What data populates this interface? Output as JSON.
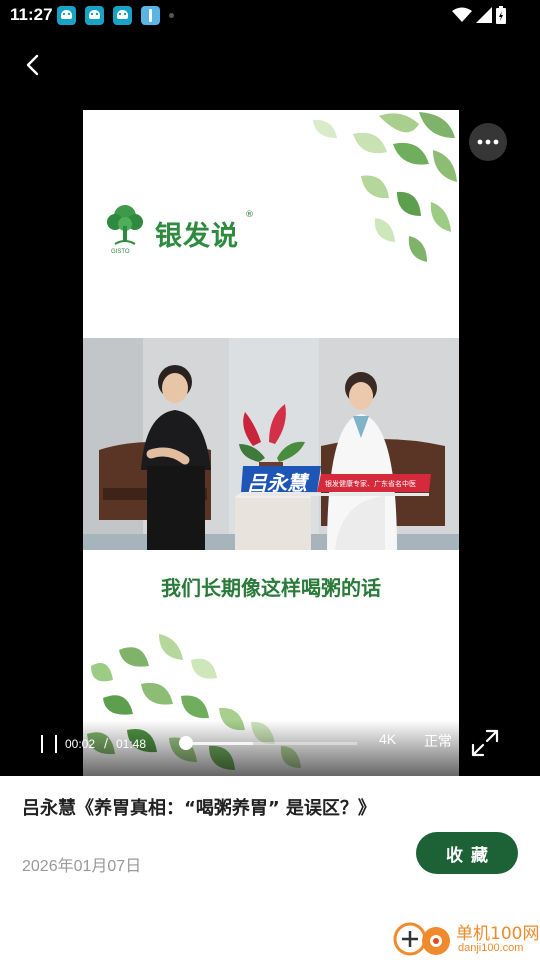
{
  "status_bar": {
    "time": "11:27",
    "notification_icons": [
      "app-notification-icon",
      "app-notification-icon",
      "app-notification-icon",
      "info-notification-icon"
    ],
    "system_icons": [
      "wifi-icon",
      "cellular-signal-icon",
      "battery-icon"
    ]
  },
  "video": {
    "logo_name": "银发说",
    "logo_sub": "GISTO",
    "logo_registered": "®",
    "speaker_name": "吕永慧",
    "speaker_title": "银发健康专家、广东省名中医",
    "caption": "我们长期像这样喝粥的话",
    "controls": {
      "current_time": "00:02",
      "separator": "/",
      "total_time": "01:48",
      "progress_fraction": 0.02,
      "buffered_fraction": 0.4,
      "quality": "4K",
      "speed": "正常"
    }
  },
  "info": {
    "title": "吕永慧《养胃真相：“喝粥养胃” 是误区？》",
    "date": "2026年01月07日",
    "favorite_label": "收藏"
  },
  "watermark": {
    "name": "单机100网",
    "url": "danji100.com"
  },
  "colors": {
    "brand_green": "#1d6137",
    "leaf_green": "#6fae5c",
    "caption_green": "#2a7a3a",
    "banner_blue": "#1e56b8",
    "watermark_orange": "#f08a2c"
  }
}
